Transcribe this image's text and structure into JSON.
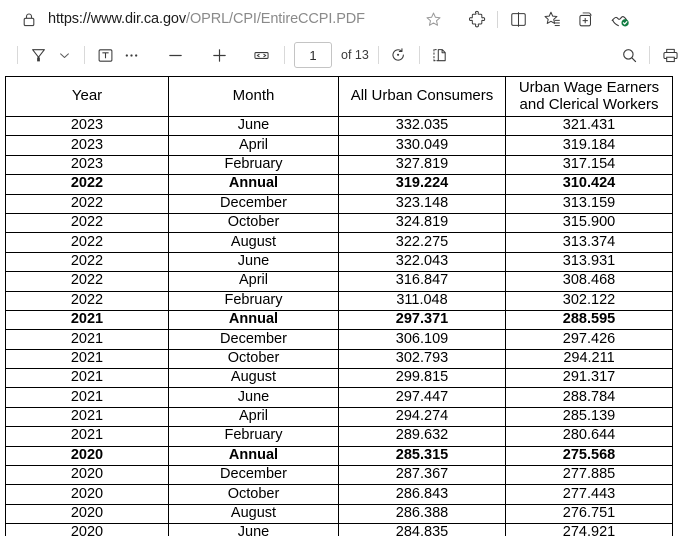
{
  "browser": {
    "url_host": "https://www.dir.ca.gov",
    "url_path": "/OPRL/CPI/EntireCCPI.PDF",
    "lock_icon": "lock-icon",
    "bookmark_icon": "star-icon",
    "actions": [
      {
        "name": "extensions-icon",
        "label": "Extensions"
      },
      {
        "name": "split-screen-icon",
        "label": "Split screen"
      },
      {
        "name": "collections-icon",
        "label": "Collections"
      },
      {
        "name": "add-to-collection-icon",
        "label": "Add to collection"
      },
      {
        "name": "drop-icon",
        "label": "Drop"
      }
    ]
  },
  "pdf_toolbar": {
    "highlight_icon": "highlighter-icon",
    "highlight_dropdown_icon": "chevron-down-icon",
    "text_icon": "add-text-icon",
    "more_icon": "more-options-icon",
    "zoom_out_icon": "zoom-out-icon",
    "zoom_in_icon": "zoom-in-icon",
    "fit_icon": "fit-to-width-icon",
    "page_number": "1",
    "page_count_label": "of 13",
    "rotate_icon": "rotate-icon",
    "page_view_icon": "page-view-icon",
    "search_icon": "search-icon",
    "print_icon": "print-icon"
  },
  "table": {
    "headers": [
      "Year",
      "Month",
      "All Urban Consumers",
      "Urban Wage Earners and Clerical Workers"
    ],
    "rows": [
      {
        "year": "2023",
        "month": "June",
        "auc": "332.035",
        "uwe": "321.431",
        "annual": false
      },
      {
        "year": "2023",
        "month": "April",
        "auc": "330.049",
        "uwe": "319.184",
        "annual": false
      },
      {
        "year": "2023",
        "month": "February",
        "auc": "327.819",
        "uwe": "317.154",
        "annual": false
      },
      {
        "year": "2022",
        "month": "Annual",
        "auc": "319.224",
        "uwe": "310.424",
        "annual": true
      },
      {
        "year": "2022",
        "month": "December",
        "auc": "323.148",
        "uwe": "313.159",
        "annual": false
      },
      {
        "year": "2022",
        "month": "October",
        "auc": "324.819",
        "uwe": "315.900",
        "annual": false
      },
      {
        "year": "2022",
        "month": "August",
        "auc": "322.275",
        "uwe": "313.374",
        "annual": false
      },
      {
        "year": "2022",
        "month": "June",
        "auc": "322.043",
        "uwe": "313.931",
        "annual": false
      },
      {
        "year": "2022",
        "month": "April",
        "auc": "316.847",
        "uwe": "308.468",
        "annual": false
      },
      {
        "year": "2022",
        "month": "February",
        "auc": "311.048",
        "uwe": "302.122",
        "annual": false
      },
      {
        "year": "2021",
        "month": "Annual",
        "auc": "297.371",
        "uwe": "288.595",
        "annual": true
      },
      {
        "year": "2021",
        "month": "December",
        "auc": "306.109",
        "uwe": "297.426",
        "annual": false
      },
      {
        "year": "2021",
        "month": "October",
        "auc": "302.793",
        "uwe": "294.211",
        "annual": false
      },
      {
        "year": "2021",
        "month": "August",
        "auc": "299.815",
        "uwe": "291.317",
        "annual": false
      },
      {
        "year": "2021",
        "month": "June",
        "auc": "297.447",
        "uwe": "288.784",
        "annual": false
      },
      {
        "year": "2021",
        "month": "April",
        "auc": "294.274",
        "uwe": "285.139",
        "annual": false
      },
      {
        "year": "2021",
        "month": "February",
        "auc": "289.632",
        "uwe": "280.644",
        "annual": false
      },
      {
        "year": "2020",
        "month": "Annual",
        "auc": "285.315",
        "uwe": "275.568",
        "annual": true
      },
      {
        "year": "2020",
        "month": "December",
        "auc": "287.367",
        "uwe": "277.885",
        "annual": false
      },
      {
        "year": "2020",
        "month": "October",
        "auc": "286.843",
        "uwe": "277.443",
        "annual": false
      },
      {
        "year": "2020",
        "month": "August",
        "auc": "286.388",
        "uwe": "276.751",
        "annual": false
      },
      {
        "year": "2020",
        "month": "June",
        "auc": "284.835",
        "uwe": "274.921",
        "annual": false
      }
    ]
  }
}
